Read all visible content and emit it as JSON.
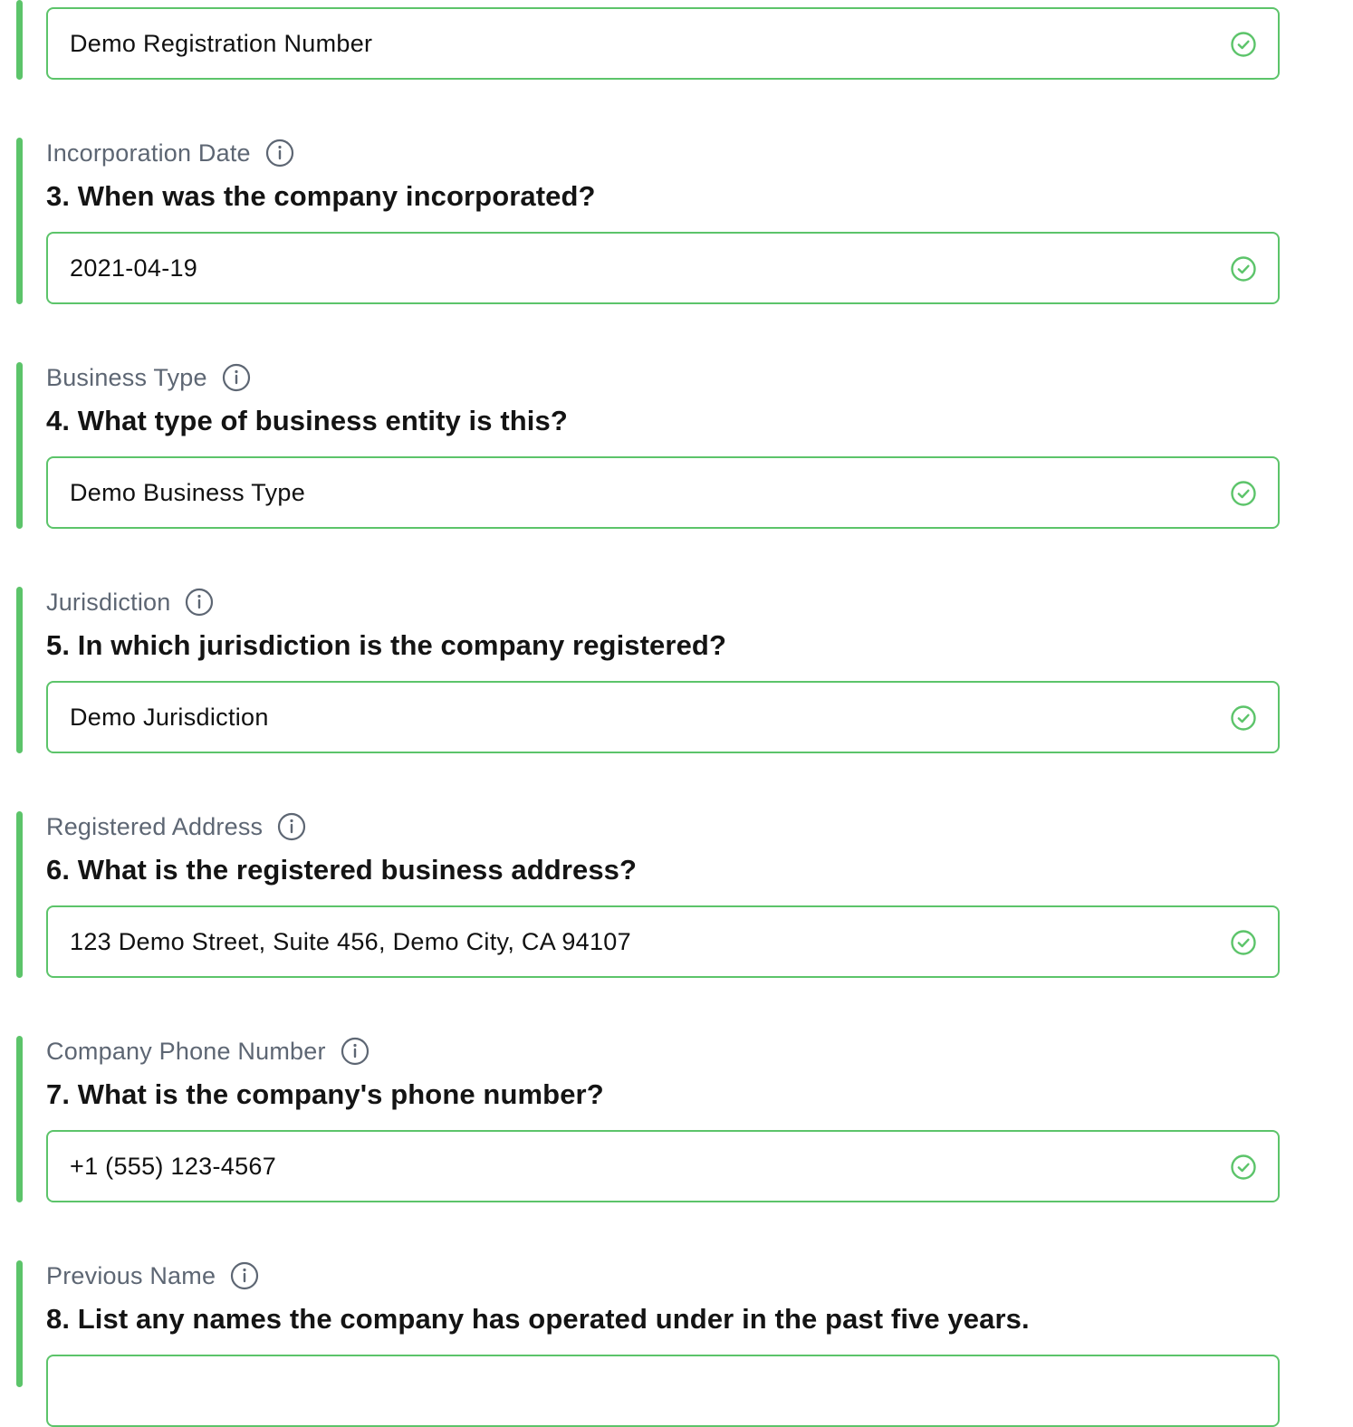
{
  "colors": {
    "accent": "#5cc46a",
    "label": "#5d6673",
    "question": "#141414",
    "value": "#111111"
  },
  "fields": [
    {
      "label": "",
      "question": "",
      "value": "Demo Registration Number",
      "status_icon": "check-circle-icon"
    },
    {
      "label": "Incorporation Date",
      "info_icon": "info-icon",
      "question": "3. When was the company incorporated?",
      "value": "2021-04-19",
      "status_icon": "check-circle-icon"
    },
    {
      "label": "Business Type",
      "info_icon": "info-icon",
      "question": "4. What type of business entity is this?",
      "value": "Demo Business Type",
      "status_icon": "check-circle-icon"
    },
    {
      "label": "Jurisdiction",
      "info_icon": "info-icon",
      "question": "5. In which jurisdiction is the company registered?",
      "value": "Demo Jurisdiction",
      "status_icon": "check-circle-icon"
    },
    {
      "label": "Registered Address",
      "info_icon": "info-icon",
      "question": "6. What is the registered business address?",
      "value": "123 Demo Street, Suite 456, Demo City, CA 94107",
      "status_icon": "check-circle-icon"
    },
    {
      "label": "Company Phone Number",
      "info_icon": "info-icon",
      "question": "7. What is the company's phone number?",
      "value": "+1 (555) 123-4567",
      "status_icon": "check-circle-icon"
    },
    {
      "label": "Previous Name",
      "info_icon": "info-icon",
      "question": "8. List any names the company has operated under in the past five years.",
      "value": "",
      "status_icon": ""
    }
  ]
}
